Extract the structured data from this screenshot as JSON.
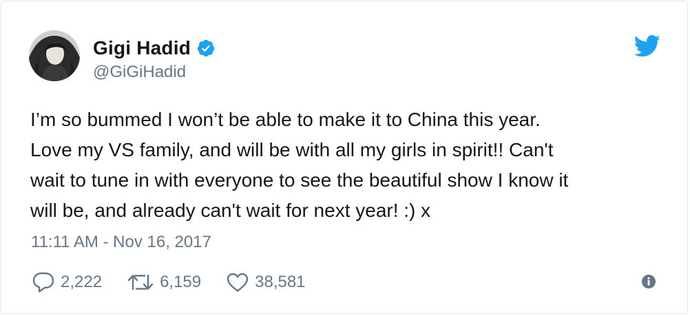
{
  "author": {
    "display_name": "Gigi Hadid",
    "handle": "@GiGiHadid",
    "verified": true
  },
  "tweet": {
    "lines": [
      "I’m so bummed I won’t be able to make it to China this year.",
      "Love my VS family, and will be with all my girls in spirit!! Can't",
      "wait to tune in with everyone to see the beautiful show I know it",
      "will be, and already can't wait for next year! :) x"
    ],
    "timestamp": "11:11 AM - Nov 16, 2017"
  },
  "actions": {
    "replies": "2,222",
    "retweets": "6,159",
    "likes": "38,581"
  },
  "icons": {
    "verified": "verified-badge-icon",
    "brand": "twitter-bird-icon",
    "reply": "reply-icon",
    "retweet": "retweet-icon",
    "like": "heart-icon",
    "info": "info-icon"
  },
  "colors": {
    "twitter_blue": "#1da1f2",
    "text_primary": "#14171a",
    "text_secondary": "#657786",
    "border": "#e1e8ed"
  }
}
